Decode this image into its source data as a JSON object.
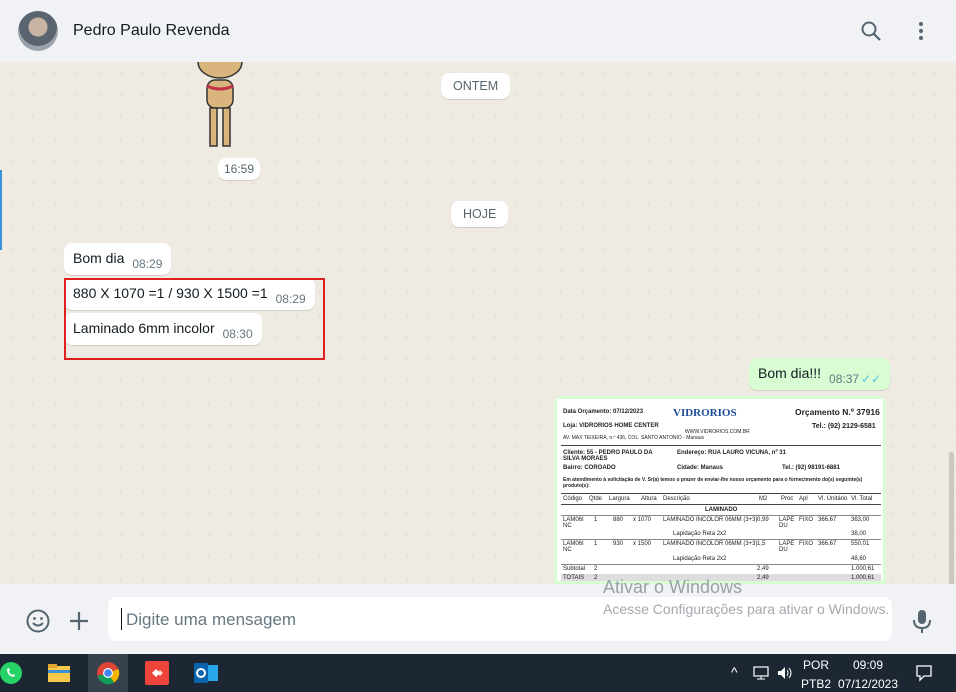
{
  "header": {
    "contact_name": "Pedro Paulo Revenda"
  },
  "chat": {
    "date_yesterday": "ONTEM",
    "sticker_time": "16:59",
    "date_today": "HOJE",
    "messages": [
      {
        "text": "Bom dia",
        "time": "08:29"
      },
      {
        "text": "880 X 1070 =1 / 930 X 1500 =1",
        "time": "08:29"
      },
      {
        "text": "Laminado 6mm incolor",
        "time": "08:30"
      },
      {
        "text": "Bom dia!!!",
        "time": "08:37"
      }
    ],
    "document": {
      "date_label": "Data Orçamento: 07/12/2023",
      "brand": "VIDRORIOS",
      "quote_number": "Orçamento N.º 37916",
      "store": "Loja: VIDRORIOS HOME CENTER",
      "site": "WWW.VIDRORIOS.COM.BR",
      "phone": "Tel.: (92) 2129-6581",
      "address": "AV. MAX TEIXEIRA, n.º 436, COL. SANTO ANTONIO - Manaus",
      "client": "Cliente: 55 - PEDRO PAULO DA SILVA MORAES",
      "client_address": "Endereço: RUA LAURO VICUNA, nº 31",
      "neighborhood": "Bairro: COROADO",
      "city": "Cidade: Manaus",
      "client_phone": "Tel.: (92) 98191-6881",
      "intro": "Em atendimento à solicitação de V. Sr(a) temos o prazer de enviar-lhe nosso orçamento para o fornecimento do(s) seguinte(s) produto(s):",
      "columns": [
        "Código",
        "Qtde",
        "Largura",
        "Altura",
        "Descrição",
        "M2",
        "Proc",
        "Apl",
        "Vl. Unitário",
        "Vl. Total"
      ],
      "section": "LAMINADO",
      "rows": [
        [
          "LAM06I NC",
          "1",
          "880",
          "x 1070",
          "LAMINADO INCOLOR 06MM (3+3)",
          "0,99",
          "LAPE DU",
          "FIXO",
          "366,67",
          "363,00"
        ],
        [
          "",
          "",
          "",
          "",
          "Lapidação Reta 2x2",
          "",
          "",
          "",
          "",
          "38,00"
        ],
        [
          "LAM06I NC",
          "1",
          "930",
          "x 1500",
          "LAMINADO INCOLOR 06MM (3+3)",
          "1,5",
          "LAPE DU",
          "FIXO",
          "366,67",
          "550,01"
        ],
        [
          "",
          "",
          "",
          "",
          "Lapidação Reta 2x2",
          "",
          "",
          "",
          "",
          "48,60"
        ]
      ],
      "subtotal_label": "Subtotal",
      "subtotal_qty": "2",
      "subtotal_m2": "2,49",
      "subtotal_value": "1.000,61",
      "total_label": "TOTAIS",
      "total_qty": "2",
      "total_m2": "2,49",
      "total_value": "1.000,61"
    }
  },
  "input": {
    "placeholder": "Digite uma mensagem"
  },
  "watermark": {
    "line1": "Ativar o Windows",
    "line2": "Acesse Configurações para ativar o Windows."
  },
  "taskbar": {
    "lang1": "POR",
    "lang2": "PTB2",
    "time": "09:09",
    "date": "07/12/2023"
  }
}
